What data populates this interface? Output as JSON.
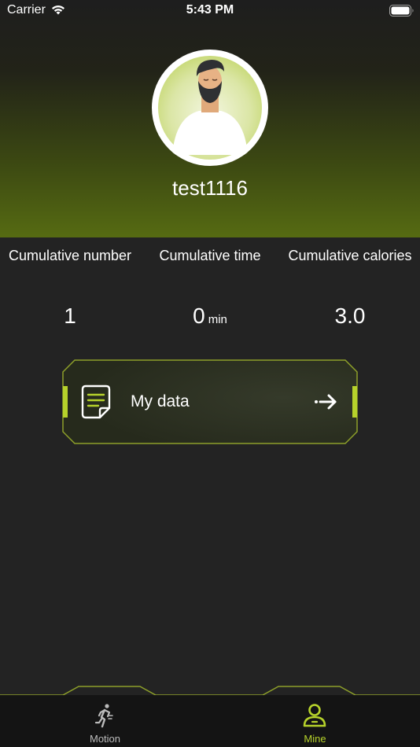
{
  "status_bar": {
    "carrier": "Carrier",
    "time": "5:43 PM"
  },
  "profile": {
    "username": "test1116"
  },
  "stats": [
    {
      "label": "Cumulative number",
      "value": "1",
      "unit": ""
    },
    {
      "label": "Cumulative time",
      "value": "0",
      "unit": "min"
    },
    {
      "label": "Cumulative calories",
      "value": "3.0",
      "unit": ""
    }
  ],
  "my_data": {
    "label": "My data"
  },
  "tabbar": {
    "tabs": [
      {
        "label": "Motion",
        "icon": "running-icon",
        "active": false
      },
      {
        "label": "Mine",
        "icon": "user-icon",
        "active": true
      }
    ]
  },
  "colors": {
    "accent": "#b6d22b",
    "background": "#232323",
    "tabbar": "#141414",
    "inactive_tab": "#bbbbbb"
  }
}
